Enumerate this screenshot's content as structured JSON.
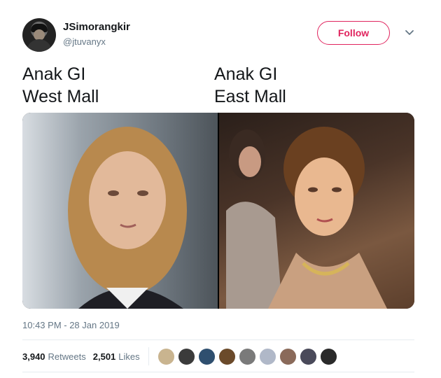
{
  "user": {
    "name": "JSimorangkir",
    "handle": "@jtuvanyx",
    "avatar_icon": "user-avatar"
  },
  "follow_label": "Follow",
  "tweet": {
    "left_line1": "Anak GI",
    "left_line2": "West Mall",
    "right_line1": "Anak GI",
    "right_line2": "East Mall"
  },
  "timestamp": "10:43 PM - 28 Jan 2019",
  "stats": {
    "retweets_count": "3,940",
    "retweets_label": "Retweets",
    "likes_count": "2,501",
    "likes_label": "Likes"
  },
  "colors": {
    "accent": "#e0245e",
    "muted": "#657786",
    "text": "#14171a"
  },
  "liker_colors": [
    "#c9b48f",
    "#3b3b3b",
    "#2f4f6f",
    "#6b4a2a",
    "#7a7a7a",
    "#b0b8c8",
    "#8a6a5a",
    "#4a4a5a",
    "#2a2a2a"
  ]
}
